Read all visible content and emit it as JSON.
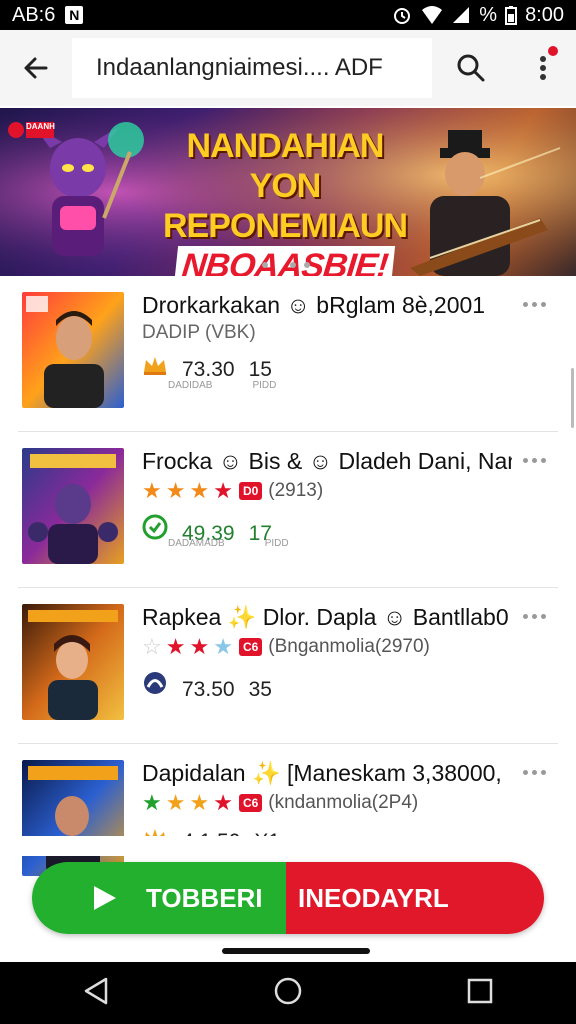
{
  "status_bar": {
    "left_text": "AB:6",
    "left_badge": "N",
    "battery_pct": "%",
    "time": "8:00"
  },
  "app_bar": {
    "search_text": "Indaanlangniaimesi.... ADF",
    "icons": [
      "back-arrow-icon",
      "search-icon",
      "more-vert-icon"
    ]
  },
  "banner": {
    "line1": "NANDAHIAN YON",
    "line2": "REPONEMIAUN",
    "line3": "NBOAASBIE!",
    "badge": "DAANH",
    "page_count": 4,
    "active_page": 2
  },
  "items": [
    {
      "title": "Drorkarkakan ☺ bRglam 8è,2001",
      "subtitle": "DADIP (VBK)",
      "rating_value": "73.30",
      "rating_count": "15",
      "stat_unit": "DADIDAB",
      "stat_tag": "PIDD",
      "icon": "crown-icon",
      "thumb_label": "DAKDNAB",
      "thumb_colors": [
        "#ff3b3b",
        "#ffa21a",
        "#2b5fd0"
      ]
    },
    {
      "title": "Frocka ☺ Bis & ☺ Dladeh Dani, Nand",
      "stars": [
        "orange",
        "orange",
        "orange",
        "red"
      ],
      "badge": "D0",
      "review_count": "(2913)",
      "rating_value": "49.39",
      "rating_count": "17",
      "stat_unit": "DADAMADB",
      "stat_tag": "PIDD",
      "icon": "shield-check-icon",
      "thumb_label": "DAHEMARE",
      "thumb_colors": [
        "#2a3a8a",
        "#8a2a9a",
        "#e6a020"
      ]
    },
    {
      "title": "Rapkea ✨ Dlor. Dapla ☺ Bantllab0",
      "stars": [
        "outline",
        "red",
        "red",
        "blue"
      ],
      "badge": "C6",
      "review_count": "(Bnganmolia(2970)",
      "rating_value": "73.50",
      "rating_count": "35",
      "stat_unit": "",
      "stat_tag": "",
      "icon": "circle-logo-icon",
      "thumb_label": "ALBAMODA",
      "thumb_colors": [
        "#3a1a0a",
        "#d46a1a",
        "#f2c040"
      ]
    },
    {
      "title": "Dapidalan ✨ [Maneskam 3,38000,",
      "stars": [
        "green",
        "orange",
        "orange",
        "red"
      ],
      "badge": "C6",
      "review_count": "(kndanmolia(2P4)",
      "rating_value": "4.1.50",
      "rating_count": "X1",
      "icon": "crown-icon",
      "thumb_label": "DAENDIA",
      "thumb_colors": [
        "#0a1a4a",
        "#2b5fd0",
        "#e6a020"
      ]
    }
  ],
  "actions": {
    "primary_label": "TOBBERI",
    "secondary_label": "INEODAYRL",
    "primary_color": "#22b02e",
    "secondary_color": "#e0182a"
  },
  "nav": {
    "icons": [
      "back-triangle-icon",
      "home-circle-icon",
      "recents-square-icon"
    ]
  }
}
